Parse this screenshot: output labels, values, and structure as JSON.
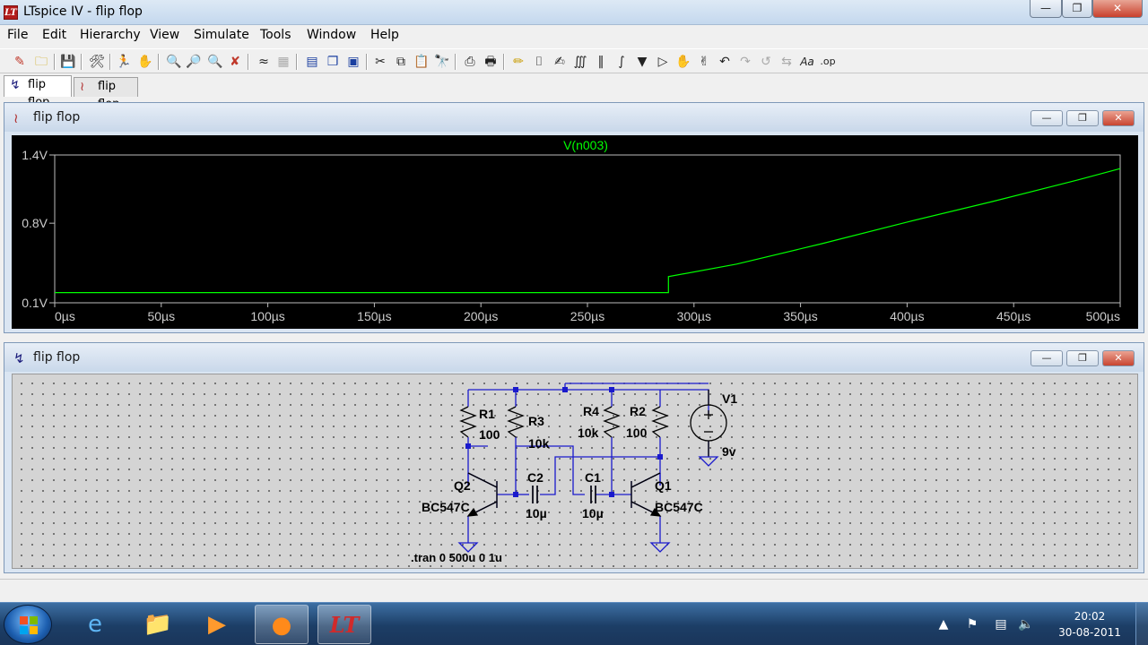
{
  "window": {
    "title": "LTspice IV - flip flop",
    "app_icon": "LT"
  },
  "menu": [
    "File",
    "Edit",
    "Hierarchy",
    "View",
    "Simulate",
    "Tools",
    "Window",
    "Help"
  ],
  "tabs": [
    {
      "label": "flip flop",
      "icon": "schematic-icon"
    },
    {
      "label": "flip flop",
      "icon": "waveform-icon"
    }
  ],
  "plot_window": {
    "title": "flip flop",
    "icon": "waveform-icon"
  },
  "schematic_window": {
    "title": "flip flop",
    "icon": "schematic-icon"
  },
  "chart_data": {
    "type": "line",
    "title": "V(n003)",
    "xlabel": "",
    "ylabel": "",
    "xlim": [
      0,
      500
    ],
    "ylim": [
      0.1,
      1.4
    ],
    "x_ticks": [
      "0µs",
      "50µs",
      "100µs",
      "150µs",
      "200µs",
      "250µs",
      "300µs",
      "350µs",
      "400µs",
      "450µs",
      "500µs"
    ],
    "y_ticks": [
      {
        "value": 1.4,
        "label": "1.4V"
      },
      {
        "value": 0.8,
        "label": "0.8V"
      },
      {
        "value": 0.1,
        "label": "0.1V"
      }
    ],
    "series": [
      {
        "name": "V(n003)",
        "color": "#00ff00",
        "x": [
          0,
          288,
          288,
          320,
          360,
          400,
          440,
          480,
          500
        ],
        "y": [
          0.19,
          0.19,
          0.33,
          0.44,
          0.62,
          0.81,
          0.99,
          1.18,
          1.28
        ]
      }
    ]
  },
  "schematic": {
    "components": {
      "R1": {
        "name": "R1",
        "value": "100"
      },
      "R3": {
        "name": "R3",
        "value": "10k"
      },
      "R4": {
        "name": "R4",
        "value": "10k"
      },
      "R2": {
        "name": "R2",
        "value": "100"
      },
      "C2": {
        "name": "C2",
        "value": "10µ"
      },
      "C1": {
        "name": "C1",
        "value": "10µ"
      },
      "Q2": {
        "name": "Q2",
        "value": "BC547C"
      },
      "Q1": {
        "name": "Q1",
        "value": "BC547C"
      },
      "V1": {
        "name": "V1",
        "value": "9v"
      }
    },
    "directive": ".tran 0 500u 0 1u"
  },
  "taskbar": {
    "clock_time": "20:02",
    "clock_date": "30-08-2011"
  }
}
